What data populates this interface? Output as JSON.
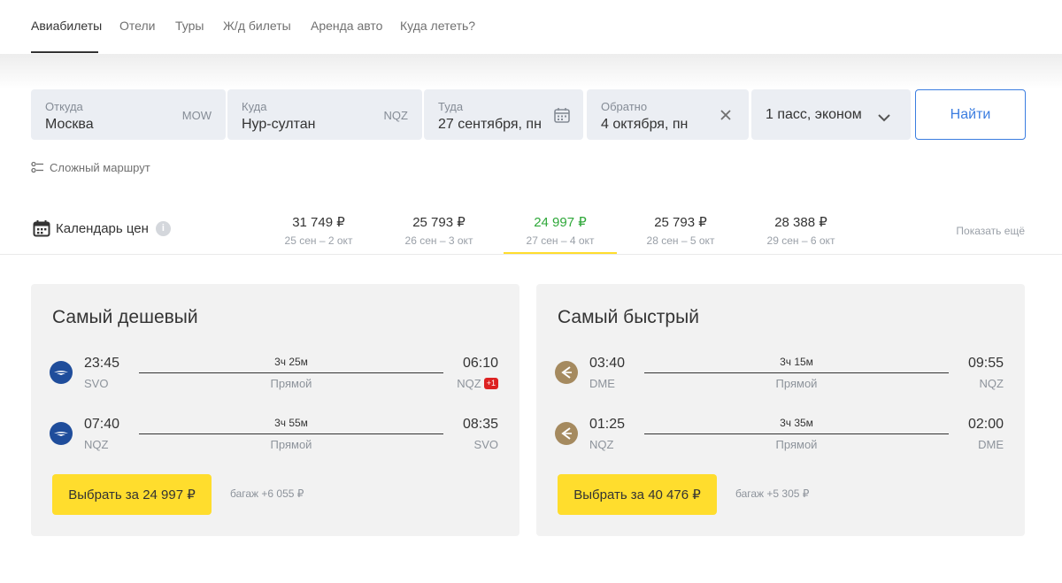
{
  "nav": {
    "tabs": [
      {
        "label": "Авиабилеты",
        "active": true
      },
      {
        "label": "Отели"
      },
      {
        "label": "Туры"
      },
      {
        "label": "Ж/д билеты"
      },
      {
        "label": "Аренда авто"
      },
      {
        "label": "Куда лететь?"
      }
    ]
  },
  "search": {
    "from": {
      "label": "Откуда",
      "value": "Москва",
      "code": "MOW"
    },
    "to": {
      "label": "Куда",
      "value": "Нур-султан",
      "code": "NQZ"
    },
    "depart": {
      "label": "Туда",
      "value": "27 сентября, пн",
      "icon": "calendar-icon"
    },
    "return": {
      "label": "Обратно",
      "value": "4 октября, пн",
      "icon": "clear-icon"
    },
    "passengers": {
      "value": "1 пасс, эконом",
      "icon": "chevron-down-icon"
    },
    "submit_label": "Найти",
    "complex_route": "Сложный маршрут"
  },
  "price_calendar": {
    "title": "Календарь цен",
    "info_icon": "info-icon",
    "items": [
      {
        "price": "31 749 ₽",
        "dates": "25 сен – 2 окт"
      },
      {
        "price": "25 793 ₽",
        "dates": "26 сен – 3 окт"
      },
      {
        "price": "24 997 ₽",
        "dates": "27 сен – 4 окт",
        "selected": true
      },
      {
        "price": "25 793 ₽",
        "dates": "28 сен – 5 окт"
      },
      {
        "price": "28 388 ₽",
        "dates": "29 сен – 6 окт"
      }
    ],
    "show_more": "Показать ещё",
    "accent_color": "#2fa83a",
    "selected_underline_color": "#ffdd2d"
  },
  "offers": [
    {
      "title": "Самый дешевый",
      "airline_icon": "aeroflot-logo-icon",
      "segments": [
        {
          "dep_time": "23:45",
          "dep_code": "SVO",
          "duration": "3ч 25м",
          "stops": "Прямой",
          "arr_time": "06:10",
          "arr_code": "NQZ",
          "next_day": "+1"
        },
        {
          "dep_time": "07:40",
          "dep_code": "NQZ",
          "duration": "3ч 55м",
          "stops": "Прямой",
          "arr_time": "08:35",
          "arr_code": "SVO"
        }
      ],
      "buy_label": "Выбрать за 24 997 ₽",
      "baggage": "багаж +6 055 ₽"
    },
    {
      "title": "Самый быстрый",
      "airline_icon": "s7-logo-icon",
      "segments": [
        {
          "dep_time": "03:40",
          "dep_code": "DME",
          "duration": "3ч 15м",
          "stops": "Прямой",
          "arr_time": "09:55",
          "arr_code": "NQZ"
        },
        {
          "dep_time": "01:25",
          "dep_code": "NQZ",
          "duration": "3ч 35м",
          "stops": "Прямой",
          "arr_time": "02:00",
          "arr_code": "DME"
        }
      ],
      "buy_label": "Выбрать за 40 476 ₽",
      "baggage": "багаж +5 305 ₽"
    }
  ],
  "colors": {
    "button_yellow": "#ffdd2d",
    "link_blue": "#3b7de0",
    "badge_red": "#dd2222"
  }
}
